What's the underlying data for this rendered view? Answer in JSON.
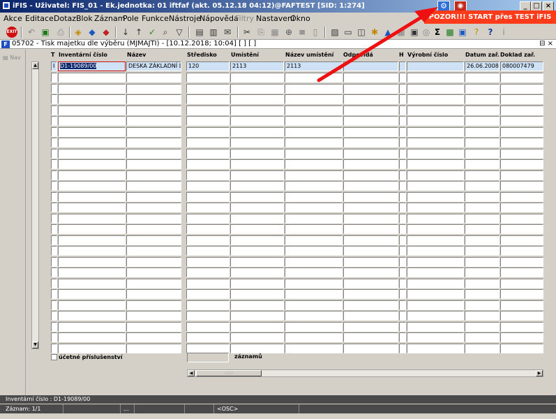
{
  "app": {
    "title": "iFIS - Uživatel: FIS_01 - Ek.jednotka: 01 iftfaf (akt. 05.12.18 04:12)@FAFTEST  [SID: 1:274]",
    "alert": "POZOR!!!  START přes TEST iFIS",
    "window_controls": [
      "_",
      "□",
      "×"
    ]
  },
  "menu": [
    "Akce",
    "Editace",
    "Dotaz",
    "Blok",
    "Záznam",
    "Pole",
    "Funkce",
    "Nástroje",
    "Nápověda",
    "Filtry",
    "Nastavení",
    "Okno"
  ],
  "inner_window": {
    "title": "05702 - Tisk majetku dle výběru (MJMAJTI) - [10.12.2018; 10:04]  [ ]  [ ]",
    "controls": "⊟ ×"
  },
  "nav": {
    "label": "Nav"
  },
  "columns": {
    "t": "T",
    "inv": "Inventární číslo",
    "nazev": "Název",
    "stredisko": "Středisko",
    "umisteni": "Umístění",
    "nazev_umisteni": "Název umístění",
    "odpovida": "Odpovídá",
    "h": "H",
    "vyrobni": "Výrobní číslo",
    "datum": "Datum zař.",
    "doklad": "Doklad zař."
  },
  "first_row": {
    "t": "I",
    "inv": "D1-19089/00",
    "nazev": "DESKA ZÁKLADNÍ Dr",
    "stredisko": "120",
    "umisteni": "2113",
    "nazev_umisteni": "2113",
    "odpovida": "",
    "h": "",
    "vyrobni": "",
    "datum": "26.06.2008",
    "doklad": "080007479"
  },
  "footer": {
    "checkbox_label": "účetné příslušenství",
    "count_label": "záznamů"
  },
  "status": {
    "line1": "Inventární číslo : D1-19089/00",
    "record": "Záznam: 1/1",
    "dots": "...",
    "mode": "<OSC>"
  },
  "colors": {
    "alert_bg": "#ff3b1a",
    "title_bg": "#0a246a",
    "arrow": "#ee1111",
    "selected_row": "#cfe1f5"
  }
}
